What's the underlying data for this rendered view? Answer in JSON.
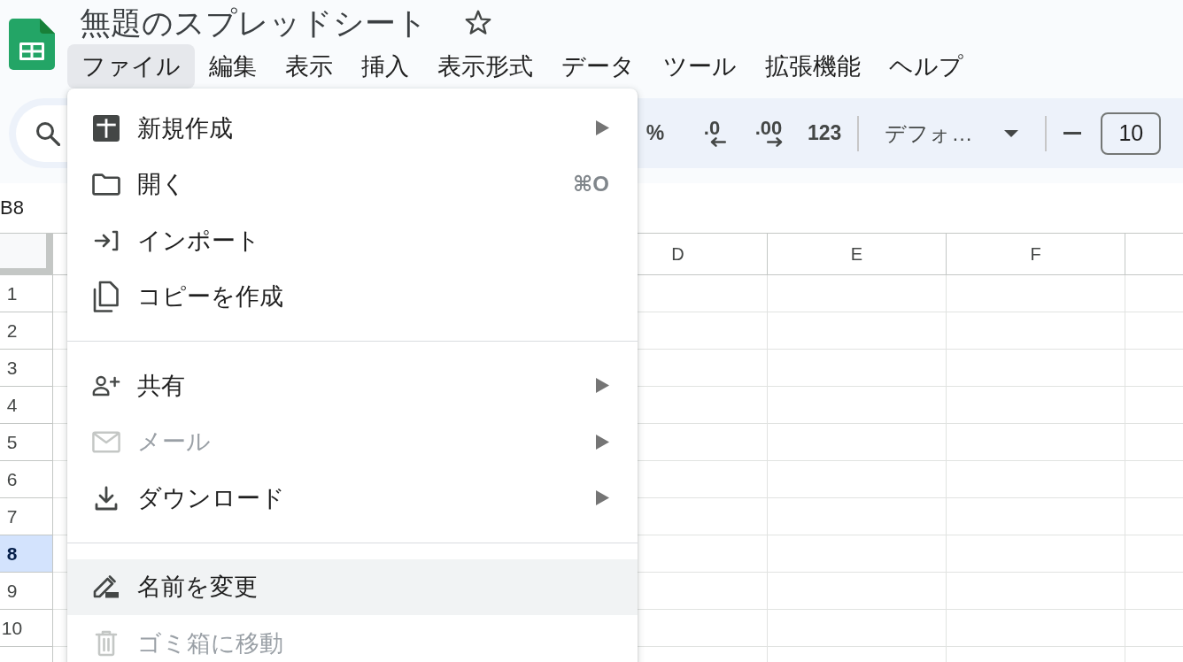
{
  "app": {
    "title": "無題のスプレッドシート",
    "starred": false
  },
  "menu_bar": [
    {
      "label": "ファイル",
      "selected": true
    },
    {
      "label": "編集",
      "selected": false
    },
    {
      "label": "表示",
      "selected": false
    },
    {
      "label": "挿入",
      "selected": false
    },
    {
      "label": "表示形式",
      "selected": false
    },
    {
      "label": "データ",
      "selected": false
    },
    {
      "label": "ツール",
      "selected": false
    },
    {
      "label": "拡張機能",
      "selected": false
    },
    {
      "label": "ヘルプ",
      "selected": false
    }
  ],
  "toolbar": {
    "items": [
      {
        "kind": "button",
        "label": "%"
      },
      {
        "kind": "decimal_decrease",
        "label": ".0"
      },
      {
        "kind": "decimal_increase",
        "label": ".00"
      },
      {
        "kind": "button",
        "label": "123"
      },
      {
        "kind": "separator"
      },
      {
        "kind": "font_select",
        "label": "デフォ…"
      },
      {
        "kind": "separator"
      },
      {
        "kind": "minus"
      },
      {
        "kind": "font_size",
        "value": "10"
      }
    ]
  },
  "formula_bar": {
    "cell_reference": "B8"
  },
  "sheet": {
    "columns": [
      "D",
      "E",
      "F"
    ],
    "rows": [
      {
        "label": "1",
        "selected": false
      },
      {
        "label": "2",
        "selected": false
      },
      {
        "label": "3",
        "selected": false
      },
      {
        "label": "4",
        "selected": false
      },
      {
        "label": "5",
        "selected": false
      },
      {
        "label": "6",
        "selected": false
      },
      {
        "label": "7",
        "selected": false
      },
      {
        "label": "8",
        "selected": true
      },
      {
        "label": "9",
        "selected": false
      },
      {
        "label": "10",
        "selected": false
      }
    ]
  },
  "file_menu": {
    "sections": [
      {
        "items": [
          {
            "label": "新規作成",
            "submenu": true,
            "disabled": false,
            "highlighted": false
          },
          {
            "label": "開く",
            "shortcut": "⌘O",
            "submenu": false,
            "disabled": false,
            "highlighted": false
          },
          {
            "label": "インポート",
            "submenu": false,
            "disabled": false,
            "highlighted": false
          },
          {
            "label": "コピーを作成",
            "submenu": false,
            "disabled": false,
            "highlighted": false
          }
        ]
      },
      {
        "items": [
          {
            "label": "共有",
            "submenu": true,
            "disabled": false,
            "highlighted": false
          },
          {
            "label": "メール",
            "submenu": true,
            "disabled": true,
            "highlighted": false
          },
          {
            "label": "ダウンロード",
            "submenu": true,
            "disabled": false,
            "highlighted": false
          }
        ]
      },
      {
        "items": [
          {
            "label": "名前を変更",
            "submenu": false,
            "disabled": false,
            "highlighted": true
          },
          {
            "label": "ゴミ箱に移動",
            "submenu": false,
            "disabled": true,
            "highlighted": false
          }
        ]
      }
    ]
  }
}
